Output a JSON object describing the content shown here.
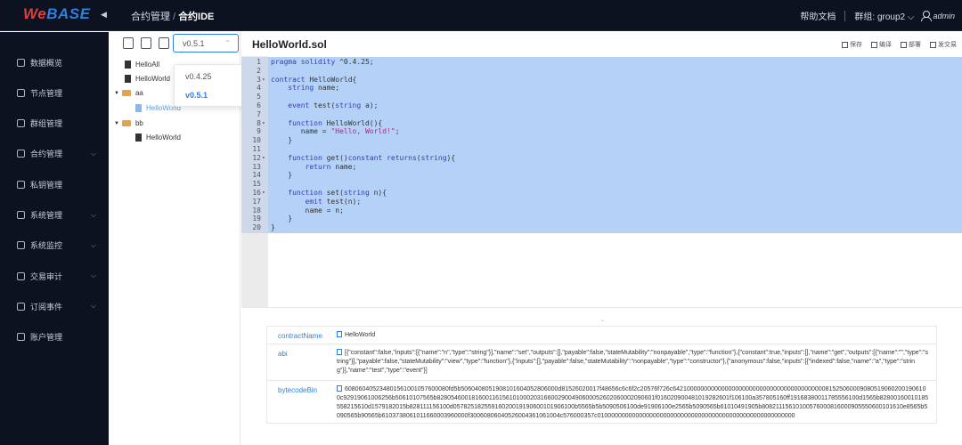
{
  "header": {
    "logo_we": "We",
    "logo_base": "BASE",
    "breadcrumb_parent": "合约管理",
    "breadcrumb_sep": "/",
    "breadcrumb_current": "合约IDE",
    "help": "帮助文档",
    "group": "群组: group2",
    "user": "admin"
  },
  "sidebar": {
    "items": [
      {
        "label": "数据概览",
        "icon": "home-icon",
        "expandable": false
      },
      {
        "label": "节点管理",
        "icon": "node-icon",
        "expandable": false
      },
      {
        "label": "群组管理",
        "icon": "group-icon",
        "expandable": false
      },
      {
        "label": "合约管理",
        "icon": "contract-icon",
        "expandable": true
      },
      {
        "label": "私钥管理",
        "icon": "lock-icon",
        "expandable": false
      },
      {
        "label": "系统管理",
        "icon": "gear-icon",
        "expandable": true
      },
      {
        "label": "系统监控",
        "icon": "monitor-icon",
        "expandable": true
      },
      {
        "label": "交易审计",
        "icon": "chart-icon",
        "expandable": true
      },
      {
        "label": "订阅事件",
        "icon": "subscribe-icon",
        "expandable": true
      },
      {
        "label": "账户管理",
        "icon": "account-icon",
        "expandable": false
      }
    ]
  },
  "tree": {
    "version_selected": "v0.5.1",
    "version_options": [
      "v0.4.25",
      "v0.5.1"
    ],
    "items": [
      {
        "label": "HelloAll",
        "type": "file"
      },
      {
        "label": "HelloWorld",
        "type": "file"
      },
      {
        "label": "aa",
        "type": "folder"
      },
      {
        "label": "HelloWorld",
        "type": "file",
        "active": true
      },
      {
        "label": "bb",
        "type": "folder"
      },
      {
        "label": "HelloWorld",
        "type": "file"
      }
    ]
  },
  "editor": {
    "filename": "HelloWorld.sol",
    "buttons": [
      "保存",
      "编译",
      "部署",
      "发交易"
    ],
    "lines": [
      "pragma solidity ^0.4.25;",
      "",
      "contract HelloWorld{",
      "    string name;",
      "",
      "    event test(string a);",
      "",
      "    function HelloWorld(){",
      "       name = \"Hello, World!\";",
      "    }",
      "",
      "    function get()constant returns(string){",
      "        return name;",
      "    }",
      "",
      "    function set(string n){",
      "        emit test(n);",
      "        name = n;",
      "    }",
      "}"
    ]
  },
  "output": {
    "rows": [
      {
        "label": "contractName",
        "value": "HelloWorld"
      },
      {
        "label": "abi",
        "value": "[{\"constant\":false,\"inputs\":[{\"name\":\"n\",\"type\":\"string\"}],\"name\":\"set\",\"outputs\":[],\"payable\":false,\"stateMutability\":\"nonpayable\",\"type\":\"function\"},{\"constant\":true,\"inputs\":[],\"name\":\"get\",\"outputs\":[{\"name\":\"\",\"type\":\"string\"}],\"payable\":false,\"stateMutability\":\"view\",\"type\":\"function\"},{\"inputs\":[],\"payable\":false,\"stateMutability\":\"nonpayable\",\"type\":\"constructor\"},{\"anonymous\":false,\"inputs\":[{\"indexed\":false,\"name\":\"a\",\"type\":\"string\"}],\"name\":\"test\",\"type\":\"event\"}]"
      },
      {
        "label": "bytecodeBin",
        "value": "608060405234801561001057600080fd5b5060408051908101604052806000d81526020017f48656c6c6f2c20576f726c64210000000000000000000000000000000000000000815250600090805190602001906100c92919061006256b50610107565b828054600181600116156101000203166002900490600052602060002090601f016020900481019282601f106100a357805160ff19168380011785556100d1565b82800160010185558215610d1579182015b828111156100d05782518255916020019190600101906100b5565b5b5090506100de91906100e2565b5090565b61010491905b80821115610100576000816000905550600101610e8565b5090565b90565b6103738061011660003960000f30060806040526004361061004c576000357c010000000000000000000000000000000000000000000000000000000"
      }
    ]
  }
}
